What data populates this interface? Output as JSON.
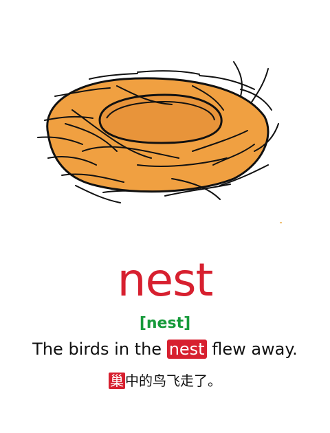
{
  "card": {
    "word": "nest",
    "phonetic": "[nest]",
    "sentence": {
      "before": "The birds in the ",
      "highlight": "nest",
      "after": " flew away."
    },
    "translation": {
      "highlight": "巢",
      "rest": "中的鸟飞走了。"
    },
    "illustration": "bird-nest",
    "colors": {
      "word": "#d7202f",
      "phonetic": "#169a3a",
      "highlight_bg": "#d7202f",
      "nest_fill": "#f0a041",
      "nest_outline": "#111111"
    }
  }
}
